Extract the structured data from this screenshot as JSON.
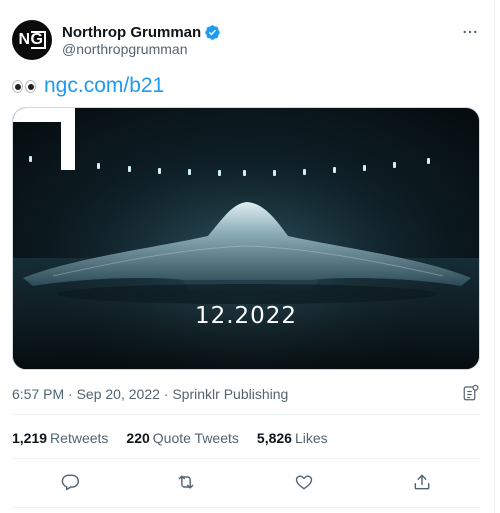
{
  "tweet": {
    "author": {
      "display_name": "Northrop Grumman",
      "handle": "@northropgrumman",
      "avatar_text": "NG",
      "verified": true
    },
    "text_emoji": "eyes",
    "text_link": "ngc.com/b21",
    "media": {
      "overlay_text": "12.2022"
    },
    "meta": {
      "time": "6:57 PM",
      "date": "Sep 20, 2022",
      "source": "Sprinklr Publishing"
    },
    "stats": {
      "retweets_count": "1,219",
      "retweets_label": "Retweets",
      "quotes_count": "220",
      "quotes_label": "Quote Tweets",
      "likes_count": "5,826",
      "likes_label": "Likes"
    },
    "icons": {
      "more": "more-icon",
      "reply": "reply-icon",
      "retweet": "retweet-icon",
      "like": "heart-icon",
      "share": "share-icon",
      "analytics": "analytics-icon"
    },
    "colors": {
      "link": "#1d9bf0",
      "verified": "#1d9bf0",
      "secondary_text": "#536471"
    }
  }
}
